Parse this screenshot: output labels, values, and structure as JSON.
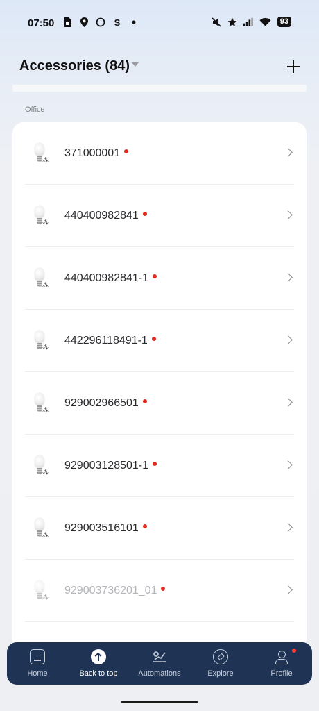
{
  "status_bar": {
    "time": "07:50",
    "left_icons": [
      "sim-card-icon",
      "location-icon",
      "circle-icon",
      "s-app-icon",
      "dot-icon"
    ],
    "s_glyph": "S",
    "right_icons": [
      "mute-vibrate-icon",
      "star-icon",
      "signal-icon",
      "wifi-icon"
    ],
    "battery": "93"
  },
  "header": {
    "title": "Accessories (84)"
  },
  "section": {
    "label": "Office"
  },
  "accessories": [
    {
      "name": "371000001",
      "alert_color": "#e02a20"
    },
    {
      "name": "440400982841",
      "alert_color": "#e02a20"
    },
    {
      "name": "440400982841-1",
      "alert_color": "#e02a20"
    },
    {
      "name": "442296118491-1",
      "alert_color": "#e02a20"
    },
    {
      "name": "929002966501",
      "alert_color": "#e02a20"
    },
    {
      "name": "929003128501-1",
      "alert_color": "#e02a20"
    },
    {
      "name": "929003516101",
      "alert_color": "#e02a20"
    },
    {
      "name": "929003736201_01",
      "alert_color": "#e02a20"
    }
  ],
  "bottom_nav": {
    "items": [
      {
        "label": "Home",
        "icon": "home-icon"
      },
      {
        "label": "Back to top",
        "icon": "arrow-up-icon"
      },
      {
        "label": "Automations",
        "icon": "automations-icon"
      },
      {
        "label": "Explore",
        "icon": "compass-icon"
      },
      {
        "label": "Profile",
        "icon": "profile-icon"
      }
    ],
    "nav_color": "#1f3454",
    "badge_color": "#ff3b30"
  }
}
